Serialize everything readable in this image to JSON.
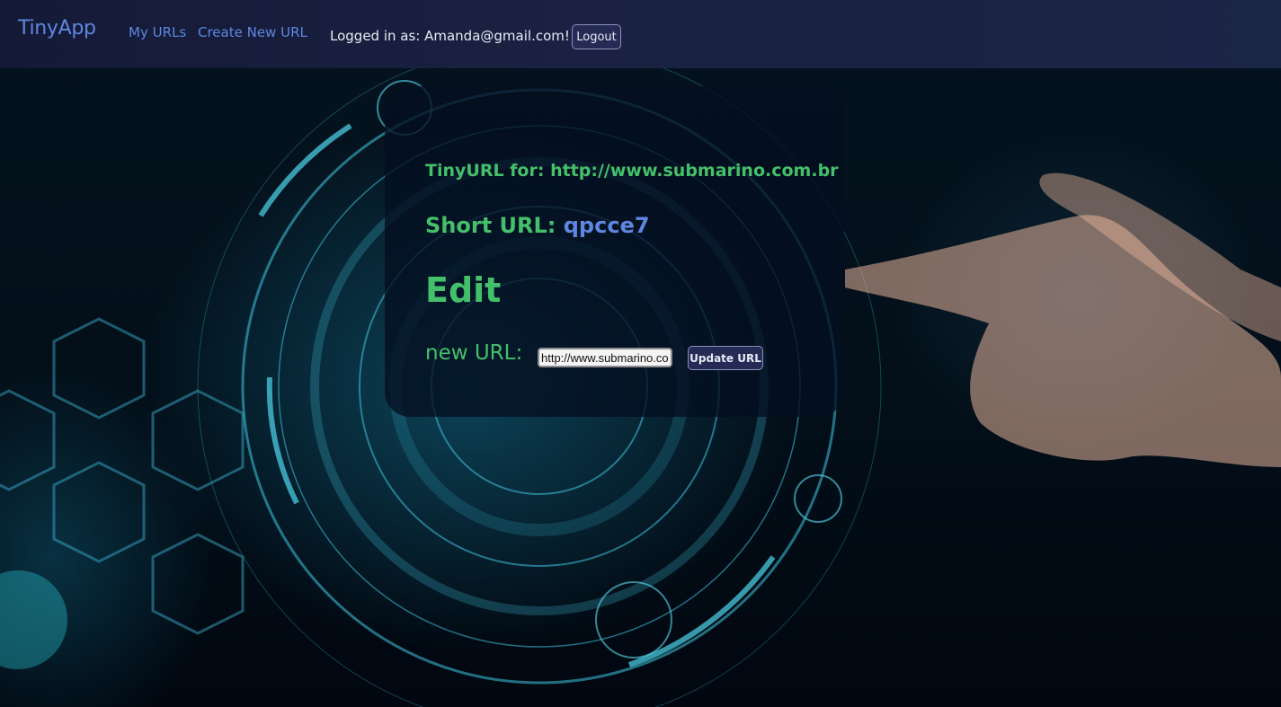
{
  "navbar": {
    "brand": "TinyApp",
    "links": {
      "my_urls": "My URLs",
      "create_new_url": "Create New URL"
    },
    "logged_in_text": "Logged in as: Amanda@gmail.com!",
    "logout_label": "Logout"
  },
  "card": {
    "tinyurl_for": "TinyURL for: http://www.submarino.com.br",
    "short_url_label": "Short URL: ",
    "short_url_code": "qpcce7",
    "edit_heading": "Edit",
    "new_url_label": "new URL:",
    "new_url_value": "http://www.submarino.com.br",
    "update_button": "Update URL"
  },
  "colors": {
    "accent_blue": "#5f86e0",
    "accent_green": "#45c06a",
    "navbar_bg": "#1a2142",
    "button_bg": "#262b55"
  }
}
